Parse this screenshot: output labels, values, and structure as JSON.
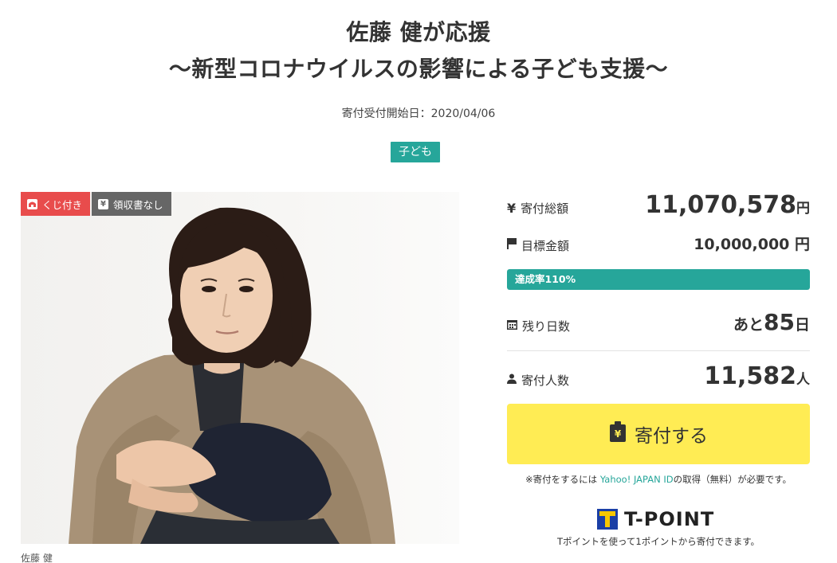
{
  "header": {
    "title_line1": "佐藤 健が応援",
    "title_line2": "～新型コロナウイルスの影響による子ども支援～",
    "start_date": "寄付受付開始日：2020/04/06",
    "category_tag": "子ども"
  },
  "photo": {
    "badges": [
      {
        "label": "くじ付き",
        "icon": "kuji-icon"
      },
      {
        "label": "領収書なし",
        "icon": "yen-receipt-icon"
      }
    ],
    "caption": "佐藤 健"
  },
  "stats": {
    "total": {
      "label": "寄付総額",
      "value": "11,070,578",
      "unit": "円",
      "icon": "yen-icon"
    },
    "goal": {
      "label": "目標金額",
      "value": "10,000,000 円",
      "icon": "flag-icon"
    },
    "achievement": {
      "label": "達成率110%",
      "percent": 110
    },
    "days_left": {
      "label": "残り日数",
      "prefix": "あと",
      "value": "85",
      "unit": "日",
      "icon": "calendar-icon"
    },
    "donors": {
      "label": "寄付人数",
      "value": "11,582",
      "unit": "人",
      "icon": "person-icon"
    }
  },
  "donate_button": {
    "label": "寄付する",
    "icon": "donate-bag-icon"
  },
  "note": {
    "prefix": "※寄付をするには ",
    "link": "Yahoo! JAPAN ID",
    "suffix": "の取得（無料）が必要です。"
  },
  "tpoint": {
    "logo_text": "T-POINT",
    "note": "Tポイントを使って1ポイントから寄付できます。"
  },
  "colors": {
    "accent": "#26a69a",
    "donate_button": "#ffec54",
    "kuji_badge": "#e84c4c",
    "receipt_badge": "#666666",
    "tpoint_blue": "#1a3fa6",
    "tpoint_yellow": "#f6c700"
  }
}
